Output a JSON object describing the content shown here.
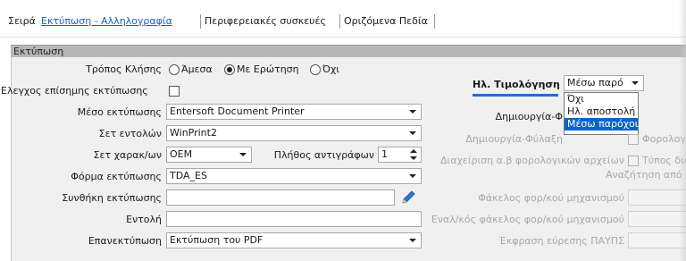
{
  "tabs": {
    "seira": "Σειρά",
    "print_correspondence": "Εκτύπωση - Αλληλογραφία",
    "peripherals": "Περιφερειακές συσκευές",
    "defined_fields": "Οριζόμενα Πεδία"
  },
  "section_title": "Εκτύπωση",
  "form": {
    "call_mode": {
      "label": "Τρόπος Κλήσης",
      "options": [
        "Άμεσα",
        "Με Ερώτηση",
        "Όχι"
      ],
      "selected": "Με Ερώτηση"
    },
    "official_print_check": {
      "label": "Ελεγχος επίσημης εκτύπωσης",
      "checked": false
    },
    "print_medium": {
      "label": "Μέσο εκτύπωσης",
      "value": "Entersoft Document Printer"
    },
    "command_set": {
      "label": "Σετ εντολών",
      "value": "WinPrint2"
    },
    "char_set": {
      "label": "Σετ χαρακ/ων",
      "value": "OEM"
    },
    "copies": {
      "label": "Πλήθος αντιγράφων",
      "value": "1"
    },
    "print_form": {
      "label": "Φόρμα εκτύπωσης",
      "value": "TDA_ES"
    },
    "print_condition": {
      "label": "Συνθήκη εκτύπωσης",
      "value": ""
    },
    "command": {
      "label": "Εντολή",
      "value": ""
    },
    "reprint": {
      "label": "Επανεκτύπωση",
      "value": "Εκτύπωση του PDF"
    }
  },
  "einvoice": {
    "title": "Ηλ. Τιμολόγηση",
    "selected_value": "Μέσω παρό",
    "options": [
      "Όχι",
      "Ηλ. αποστολή",
      "Μέσω παρόχου"
    ],
    "highlighted": "Μέσω παρόχου",
    "create_label": "Δημιουργία-Φ",
    "create_keep_label": "Δημιουργία-Φύλαξη",
    "tax_label": "Φορολογ",
    "manage_label": "Διαχείριση α.β φορολογικών αρχείων",
    "type_label": "Τύπος διά",
    "search_label": "Αναζήτηση από",
    "folder_label": "Φάκελος φορ/κού μηχανισμού",
    "alt_folder_label": "Εναλ/κός φάκελος φορ/κού μηχανισμού",
    "expr_label": "Έκφραση εύρεσης ΠΑΥΠΣ"
  }
}
